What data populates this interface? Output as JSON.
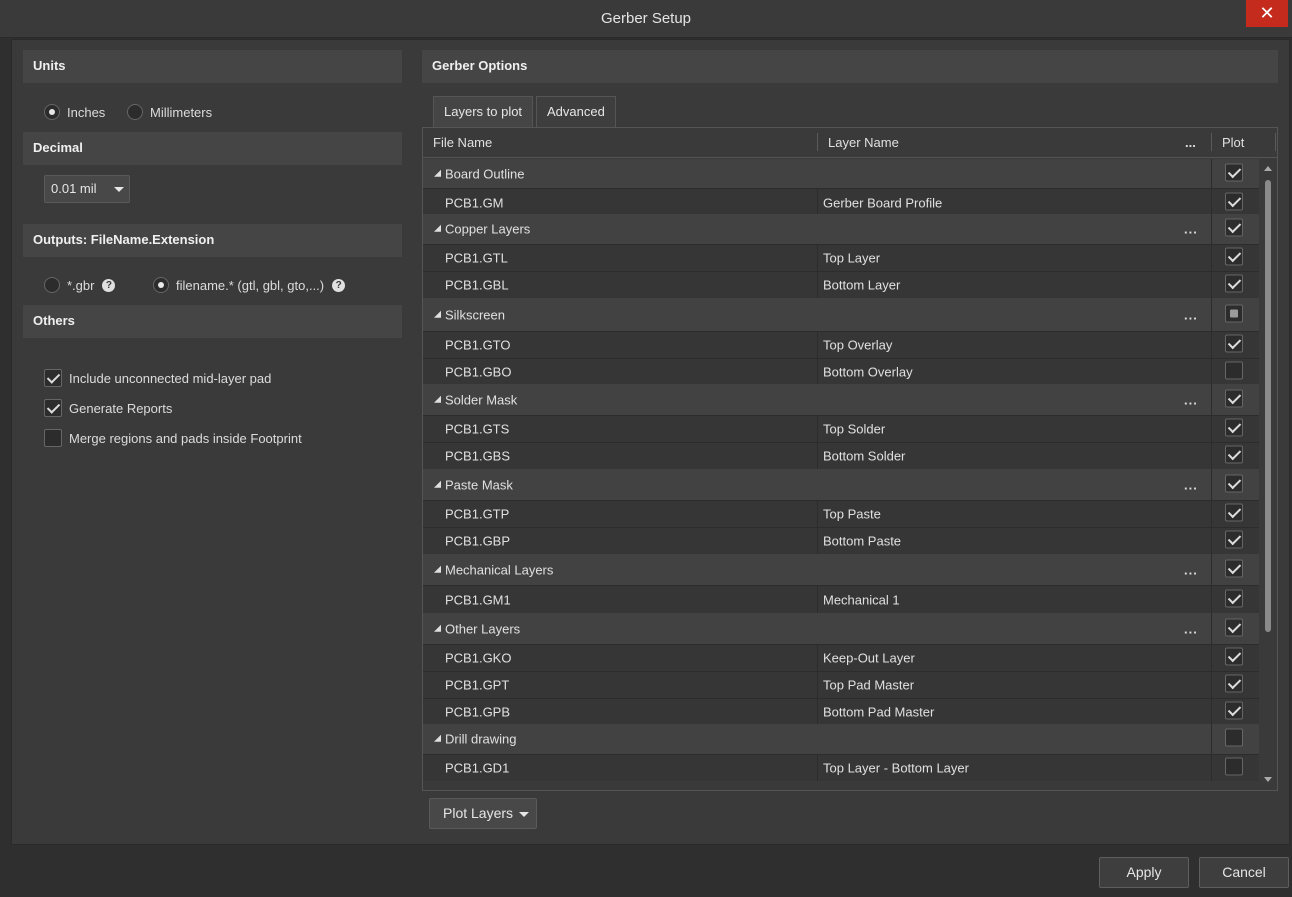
{
  "window": {
    "title": "Gerber Setup",
    "close_label": "✕"
  },
  "left": {
    "units": {
      "header": "Units",
      "options": [
        {
          "label": "Inches",
          "selected": true
        },
        {
          "label": "Millimeters",
          "selected": false
        }
      ]
    },
    "decimal": {
      "header": "Decimal",
      "value": "0.01 mil"
    },
    "outputs": {
      "header": "Outputs: FileName.Extension",
      "options": [
        {
          "label": "*.gbr",
          "selected": false
        },
        {
          "label": "filename.* (gtl, gbl, gto,...)",
          "selected": true
        }
      ]
    },
    "others": {
      "header": "Others",
      "checks": [
        {
          "label": "Include unconnected mid-layer pad",
          "checked": true
        },
        {
          "label": "Generate Reports",
          "checked": true
        },
        {
          "label": "Merge regions and pads inside Footprint",
          "checked": false
        }
      ]
    }
  },
  "right": {
    "header": "Gerber Options",
    "tabs": [
      {
        "label": "Layers to plot",
        "active": false
      },
      {
        "label": "Advanced",
        "active": true
      }
    ],
    "columns": {
      "file_name": "File Name",
      "layer_name": "Layer Name",
      "more": "...",
      "plot": "Plot"
    },
    "groups": [
      {
        "name": "Board Outline",
        "dots": "",
        "state": "on",
        "rows": [
          {
            "file": "PCB1.GM",
            "layer": "Gerber Board Profile",
            "plot": true
          }
        ]
      },
      {
        "name": "Copper Layers",
        "dots": "...",
        "state": "on",
        "rows": [
          {
            "file": "PCB1.GTL",
            "layer": "Top Layer",
            "plot": true
          },
          {
            "file": "PCB1.GBL",
            "layer": "Bottom Layer",
            "plot": true
          }
        ]
      },
      {
        "name": "Silkscreen",
        "dots": "...",
        "state": "partial",
        "rows": [
          {
            "file": "PCB1.GTO",
            "layer": "Top Overlay",
            "plot": true
          },
          {
            "file": "PCB1.GBO",
            "layer": "Bottom Overlay",
            "plot": false
          }
        ]
      },
      {
        "name": "Solder Mask",
        "dots": "...",
        "state": "on",
        "rows": [
          {
            "file": "PCB1.GTS",
            "layer": "Top Solder",
            "plot": true
          },
          {
            "file": "PCB1.GBS",
            "layer": "Bottom Solder",
            "plot": true
          }
        ]
      },
      {
        "name": "Paste Mask",
        "dots": "...",
        "state": "on",
        "rows": [
          {
            "file": "PCB1.GTP",
            "layer": "Top Paste",
            "plot": true
          },
          {
            "file": "PCB1.GBP",
            "layer": "Bottom Paste",
            "plot": true
          }
        ]
      },
      {
        "name": "Mechanical Layers",
        "dots": "...",
        "state": "on",
        "rows": [
          {
            "file": "PCB1.GM1",
            "layer": "Mechanical 1",
            "plot": true
          }
        ]
      },
      {
        "name": "Other Layers",
        "dots": "...",
        "state": "on",
        "rows": [
          {
            "file": "PCB1.GKO",
            "layer": "Keep-Out Layer",
            "plot": true
          },
          {
            "file": "PCB1.GPT",
            "layer": "Top Pad Master",
            "plot": true
          },
          {
            "file": "PCB1.GPB",
            "layer": "Bottom Pad Master",
            "plot": true
          }
        ]
      },
      {
        "name": "Drill drawing",
        "dots": "",
        "state": "off",
        "rows": [
          {
            "file": "PCB1.GD1",
            "layer": "Top Layer - Bottom Layer",
            "plot": false
          }
        ]
      }
    ],
    "plot_layers_label": "Plot Layers"
  },
  "footer": {
    "apply_label": "Apply",
    "cancel_label": "Cancel"
  }
}
